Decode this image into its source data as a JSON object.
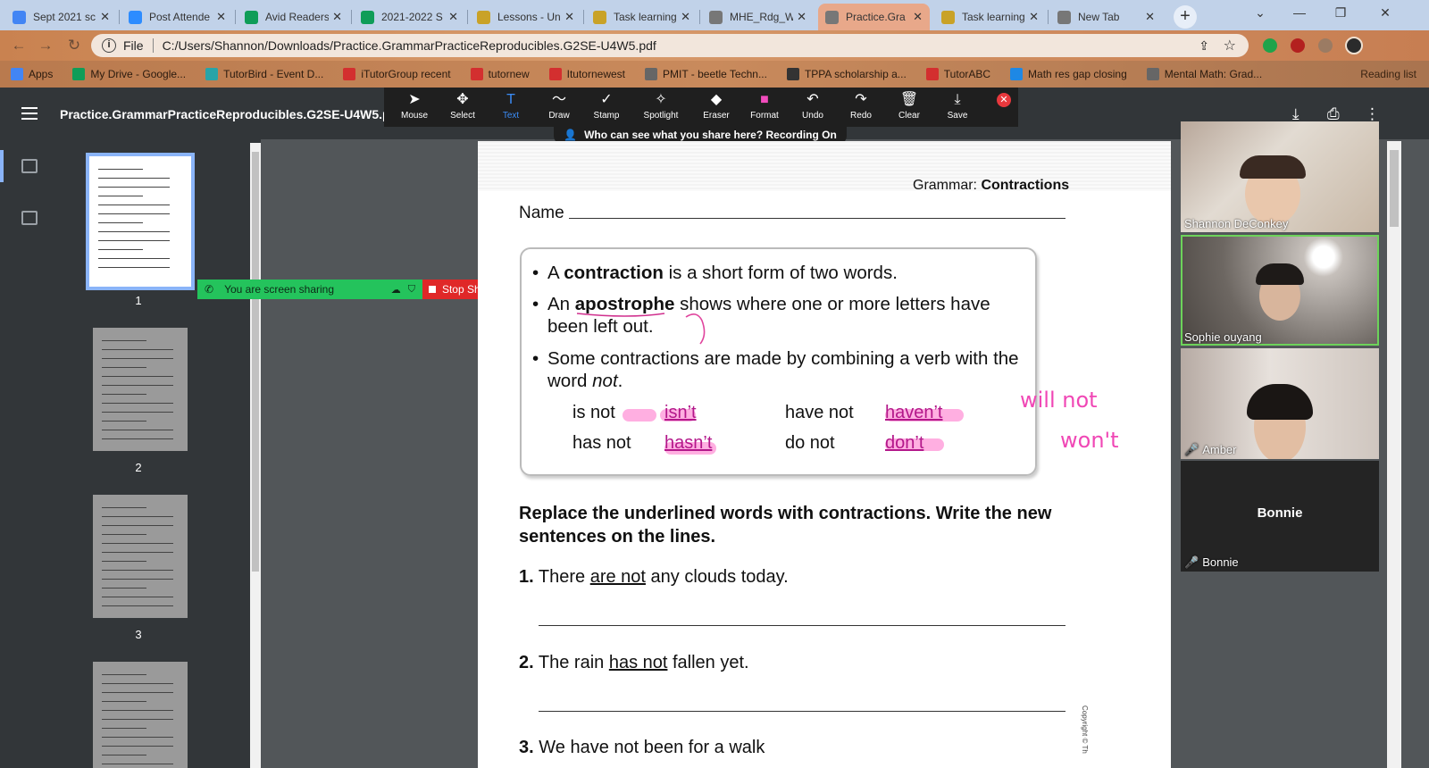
{
  "browser": {
    "tabs": [
      {
        "title": "Sept 2021 sc",
        "icon": "docs-icon",
        "color": "#4285f4"
      },
      {
        "title": "Post Attende",
        "icon": "zoom-icon",
        "color": "#2d8cff"
      },
      {
        "title": "Avid Readers",
        "icon": "drive-icon",
        "color": "#0f9d58"
      },
      {
        "title": "2021-2022 S",
        "icon": "sheets-icon",
        "color": "#0f9d58"
      },
      {
        "title": "Lessons - Un",
        "icon": "classroom-icon",
        "color": "#c9a227"
      },
      {
        "title": "Task learning",
        "icon": "classroom-icon",
        "color": "#c9a227"
      },
      {
        "title": "MHE_Rdg_W",
        "icon": "chrome-icon",
        "color": "#777777"
      },
      {
        "title": "Practice.Gra",
        "icon": "chrome-icon",
        "color": "#777777"
      },
      {
        "title": "Task learning",
        "icon": "classroom-icon",
        "color": "#c9a227"
      },
      {
        "title": "New Tab",
        "icon": "chrome-icon",
        "color": "#777777"
      }
    ],
    "active_tab_index": 7,
    "new_tab_label": "+",
    "address": {
      "scheme_label": "File",
      "url": "C:/Users/Shannon/Downloads/Practice.GrammarPracticeReproducibles.G2SE-U4W5.pdf"
    },
    "bookmarks": [
      {
        "label": "Apps",
        "icon": "apps-icon",
        "color": "#4285f4"
      },
      {
        "label": "My Drive - Google...",
        "icon": "drive-icon",
        "color": "#0f9d58"
      },
      {
        "label": "TutorBird - Event D...",
        "icon": "tutorbird-icon",
        "color": "#27a4a8"
      },
      {
        "label": "iTutorGroup recent",
        "icon": "itutor-icon",
        "color": "#d32f2f"
      },
      {
        "label": "tutornew",
        "icon": "itutor-icon",
        "color": "#d32f2f"
      },
      {
        "label": "Itutornewest",
        "icon": "itutor-icon",
        "color": "#d32f2f"
      },
      {
        "label": "PMIT - beetle Techn...",
        "icon": "globe-icon",
        "color": "#666666"
      },
      {
        "label": "TPPA scholarship a...",
        "icon": "soccer-icon",
        "color": "#333333"
      },
      {
        "label": "TutorABC",
        "icon": "itutor-icon",
        "color": "#d32f2f"
      },
      {
        "label": "Math res gap closing",
        "icon": "globe-icon",
        "color": "#1e88e5"
      },
      {
        "label": "Mental Math: Grad...",
        "icon": "globe-icon",
        "color": "#666666"
      }
    ],
    "reading_list_label": "Reading list"
  },
  "pdf_viewer": {
    "title": "Practice.GrammarPracticeReproducibles.G2SE-U4W5.pdf",
    "page_numbers": [
      "1",
      "2",
      "3"
    ]
  },
  "annotation_toolbar": {
    "tools": [
      {
        "label": "Mouse",
        "icon": "mouse-pointer-icon",
        "glyph": "➤"
      },
      {
        "label": "Select",
        "icon": "move-icon",
        "glyph": "✥"
      },
      {
        "label": "Text",
        "icon": "text-icon",
        "glyph": "T"
      },
      {
        "label": "Draw",
        "icon": "draw-icon",
        "glyph": "〜"
      },
      {
        "label": "Stamp",
        "icon": "check-icon",
        "glyph": "✓"
      },
      {
        "label": "Spotlight",
        "icon": "spotlight-icon",
        "glyph": "✧"
      },
      {
        "label": "Eraser",
        "icon": "eraser-icon",
        "glyph": "◆"
      },
      {
        "label": "Format",
        "icon": "format-icon",
        "glyph": "■"
      },
      {
        "label": "Undo",
        "icon": "undo-icon",
        "glyph": "↶"
      },
      {
        "label": "Redo",
        "icon": "redo-icon",
        "glyph": "↷"
      },
      {
        "label": "Clear",
        "icon": "trash-icon",
        "glyph": "🗑"
      },
      {
        "label": "Save",
        "icon": "save-icon",
        "glyph": "⤓"
      }
    ],
    "active_tool": "Text",
    "format_color": "#f24cbd",
    "banner": "Who can see what you share here? Recording On"
  },
  "screen_share": {
    "status": "You are screen sharing",
    "stop_label": "Stop Share"
  },
  "worksheet": {
    "header_prefix": "Grammar: ",
    "header_topic": "Contractions",
    "name_label": "Name",
    "rules": [
      {
        "pre": "A ",
        "bold": "contraction",
        "post": " is a short form of two words."
      },
      {
        "pre": "An ",
        "bold": "apostrophe",
        "post": " shows where one or more letters have been left out."
      },
      {
        "pre": "Some contractions are made by combining a verb with the word ",
        "bold": "",
        "post": "",
        "italic": "not",
        "end": "."
      }
    ],
    "examples": [
      {
        "words": "is not",
        "contraction": "isn’t"
      },
      {
        "words": "have not",
        "contraction": "haven’t"
      },
      {
        "words": "has not",
        "contraction": "hasn’t"
      },
      {
        "words": "do not",
        "contraction": "don’t"
      }
    ],
    "instructions": "Replace the underlined words with contractions. Write the new sentences on the lines.",
    "items": [
      {
        "num": "1.",
        "pre": "There ",
        "underlined": "are not",
        "post": " any clouds today."
      },
      {
        "num": "2.",
        "pre": "The rain ",
        "underlined": "has not",
        "post": " fallen yet."
      },
      {
        "num": "3.",
        "pre": "We have not been for a walk",
        "underlined": "",
        "post": ""
      }
    ],
    "copyright": "Copyright © Th",
    "ink_notes": [
      "will not",
      "won't"
    ],
    "ink_color": "#f047b5"
  },
  "participants": [
    {
      "name": "Shannon DeConkey",
      "muted": false
    },
    {
      "name": "Sophie ouyang",
      "muted": false
    },
    {
      "name": "Amber",
      "muted": true
    },
    {
      "name": "Bonnie",
      "muted": true
    }
  ]
}
